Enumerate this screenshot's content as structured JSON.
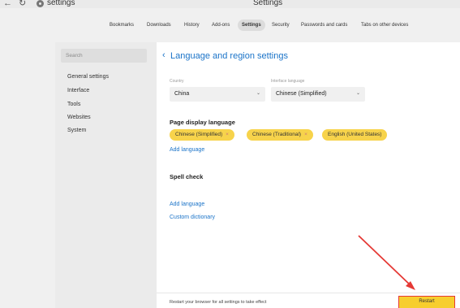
{
  "titlebar": {
    "back_icon": "←",
    "refresh_icon": "↻",
    "address": "settings",
    "window_title": "Settings"
  },
  "topnav": {
    "tabs": [
      "Bookmarks",
      "Downloads",
      "History",
      "Add-ons",
      "Settings",
      "Security",
      "Passwords and cards",
      "Tabs on other devices"
    ],
    "active": "Settings"
  },
  "sidebar": {
    "search_placeholder": "Search",
    "items": [
      "General settings",
      "Interface",
      "Tools",
      "Websites",
      "System"
    ]
  },
  "main": {
    "back_icon": "‹",
    "title": "Language and region settings",
    "country_label": "Country",
    "country_value": "China",
    "interface_label": "Interface language",
    "interface_value": "Chinese (Simplified)",
    "chevron": "⌄",
    "page_display_heading": "Page display language",
    "languages": [
      "Chinese (Simplified)",
      "Chinese (Traditional)",
      "English (United States)"
    ],
    "remove_icon": "×",
    "add_language": "Add language",
    "spell_check_heading": "Spell check",
    "spell_add_language": "Add language",
    "custom_dictionary": "Custom dictionary"
  },
  "bottombar": {
    "message": "Restart your browser for all settings to take effect",
    "restart_label": "Restart"
  },
  "colors": {
    "accent_link": "#1a73c8",
    "chip_yellow": "#f7d34b",
    "restart_yellow": "#f7ce2e",
    "annotation_red": "#e53935"
  }
}
